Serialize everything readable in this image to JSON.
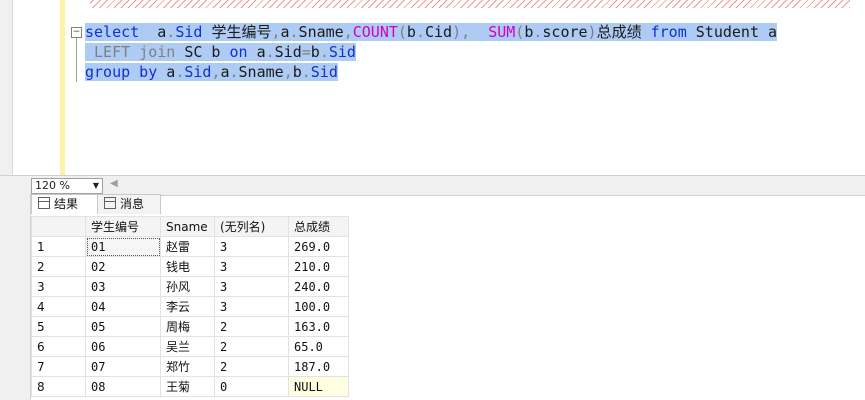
{
  "editor": {
    "lines": [
      [
        {
          "t": "select",
          "c": "kw"
        },
        {
          "t": "  a",
          "c": "bk"
        },
        {
          "t": ".",
          "c": "gy"
        },
        {
          "t": "Sid ",
          "c": "kw"
        },
        {
          "t": "学生编号",
          "c": "bk"
        },
        {
          "t": ",",
          "c": "gy"
        },
        {
          "t": "a",
          "c": "bk"
        },
        {
          "t": ".",
          "c": "gy"
        },
        {
          "t": "Sname",
          "c": "bk"
        },
        {
          "t": ",",
          "c": "gy"
        },
        {
          "t": "COUNT",
          "c": "fn"
        },
        {
          "t": "(",
          "c": "gy"
        },
        {
          "t": "b",
          "c": "bk"
        },
        {
          "t": ".",
          "c": "gy"
        },
        {
          "t": "Cid",
          "c": "bk"
        },
        {
          "t": "),  ",
          "c": "gy"
        },
        {
          "t": "SUM",
          "c": "fn"
        },
        {
          "t": "(",
          "c": "gy"
        },
        {
          "t": "b",
          "c": "bk"
        },
        {
          "t": ".",
          "c": "gy"
        },
        {
          "t": "score",
          "c": "bk"
        },
        {
          "t": ")",
          "c": "gy"
        },
        {
          "t": "总成绩 ",
          "c": "bk"
        },
        {
          "t": "from ",
          "c": "kw"
        },
        {
          "t": "Student a",
          "c": "bk"
        }
      ],
      [
        {
          "t": " LEFT join ",
          "c": "gy"
        },
        {
          "t": "SC b ",
          "c": "bk"
        },
        {
          "t": "on ",
          "c": "kw"
        },
        {
          "t": "a",
          "c": "bk"
        },
        {
          "t": ".",
          "c": "gy"
        },
        {
          "t": "Sid",
          "c": "bk"
        },
        {
          "t": "=",
          "c": "gy"
        },
        {
          "t": "b",
          "c": "bk"
        },
        {
          "t": ".",
          "c": "gy"
        },
        {
          "t": "Sid",
          "c": "kw"
        }
      ],
      [
        {
          "t": "group by ",
          "c": "kw"
        },
        {
          "t": "a",
          "c": "bk"
        },
        {
          "t": ".",
          "c": "gy"
        },
        {
          "t": "Sid",
          "c": "kw"
        },
        {
          "t": ",",
          "c": "gy"
        },
        {
          "t": "a",
          "c": "bk"
        },
        {
          "t": ".",
          "c": "gy"
        },
        {
          "t": "Sname",
          "c": "bk"
        },
        {
          "t": ",",
          "c": "gy"
        },
        {
          "t": "b",
          "c": "bk"
        },
        {
          "t": ".",
          "c": "gy"
        },
        {
          "t": "Sid",
          "c": "kw"
        }
      ]
    ],
    "colors": {
      "keyword": "#1030d8",
      "function": "#d000c8",
      "operator": "#808080",
      "selection": "#aecbf3"
    }
  },
  "zoom": {
    "value": "120 %"
  },
  "tabs": {
    "results": "结果",
    "messages": "消息"
  },
  "grid": {
    "headers": [
      "学生编号",
      "Sname",
      "(无列名)",
      "总成绩"
    ],
    "rows": [
      {
        "n": "1",
        "c": [
          "01",
          "赵雷",
          "3",
          "269.0"
        ]
      },
      {
        "n": "2",
        "c": [
          "02",
          "钱电",
          "3",
          "210.0"
        ]
      },
      {
        "n": "3",
        "c": [
          "03",
          "孙风",
          "3",
          "240.0"
        ]
      },
      {
        "n": "4",
        "c": [
          "04",
          "李云",
          "3",
          "100.0"
        ]
      },
      {
        "n": "5",
        "c": [
          "05",
          "周梅",
          "2",
          "163.0"
        ]
      },
      {
        "n": "6",
        "c": [
          "06",
          "吴兰",
          "2",
          "65.0"
        ]
      },
      {
        "n": "7",
        "c": [
          "07",
          "郑竹",
          "2",
          "187.0"
        ]
      },
      {
        "n": "8",
        "c": [
          "08",
          "王菊",
          "0",
          "NULL"
        ]
      }
    ]
  }
}
